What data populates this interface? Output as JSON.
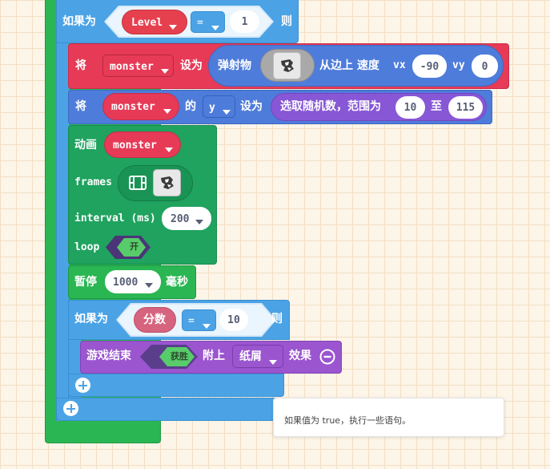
{
  "colors": {
    "background": "#fdf5e8",
    "logic_blue": "#4ba3e6",
    "sprites_red": "#e63a57",
    "sprites_blue": "#4e7cdb",
    "animation_green": "#2ab653",
    "math_purple": "#8757d6",
    "info_purple": "#9a55cf",
    "variable_pink": "#d6647e",
    "dark_purple": "#5a3e8c"
  },
  "if_block_outer": {
    "if_label": "如果为",
    "then_label": "则",
    "left_variable": "Level",
    "operator": "=",
    "right_value": "1"
  },
  "set_projectile": {
    "set_label": "将",
    "variable": "monster",
    "as_label": "设为",
    "projectile_label": "弹射物",
    "sprite_icon": "monster-sprite-icon",
    "from_side_label": "从边上 速度",
    "vx_label": "vx",
    "vx_value": "-90",
    "vy_label": "vy",
    "vy_value": "0"
  },
  "set_property": {
    "set_label": "将",
    "sprite": "monster",
    "of_label": "的",
    "property": "y",
    "as_label": "设为",
    "random_label": "选取随机数，范围为",
    "min_value": "10",
    "to_label": "至",
    "max_value": "115"
  },
  "animation": {
    "animate_label": "动画",
    "sprite": "monster",
    "frames_label": "frames",
    "film_icon": "film-icon",
    "frame_icon": "monster-sprite-icon",
    "interval_label": "interval (ms)",
    "interval_value": "200",
    "loop_label": "loop",
    "loop_value": "开"
  },
  "pause": {
    "pause_label": "暂停",
    "duration": "1000",
    "unit_label": "毫秒"
  },
  "if_block_inner": {
    "if_label": "如果为",
    "then_label": "则",
    "left_variable": "分数",
    "operator": "=",
    "right_value": "10"
  },
  "game_over": {
    "label": "游戏结束",
    "result": "获胜",
    "with_label": "附上",
    "effect": "纸屑",
    "effect_label": "效果"
  },
  "tooltip": {
    "text": "如果值为 true，执行一些语句。"
  }
}
